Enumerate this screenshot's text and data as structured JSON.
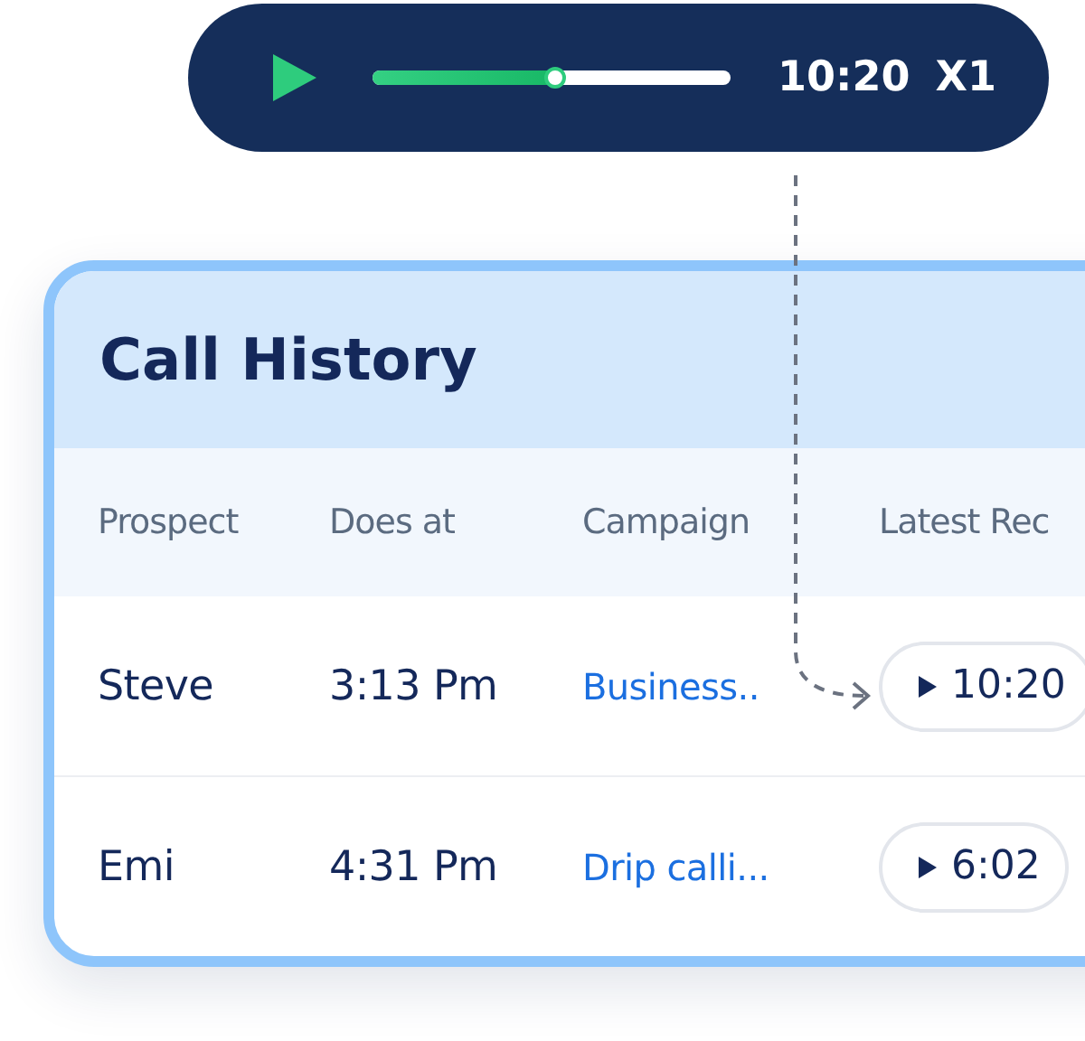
{
  "player": {
    "level": 0.51,
    "time": "10:20",
    "speed": "X1"
  },
  "call_history": {
    "title": "Call History",
    "columns": [
      "Prospect",
      "Does at",
      "Campaign",
      "Latest Rec"
    ],
    "rows": [
      {
        "prospect": "Steve",
        "time": "3:13 Pm",
        "campaign": "Business..",
        "recording": "10:20"
      },
      {
        "prospect": "Emi",
        "time": "4:31 Pm",
        "campaign": "Drip calli...",
        "recording": "6:02"
      }
    ]
  }
}
